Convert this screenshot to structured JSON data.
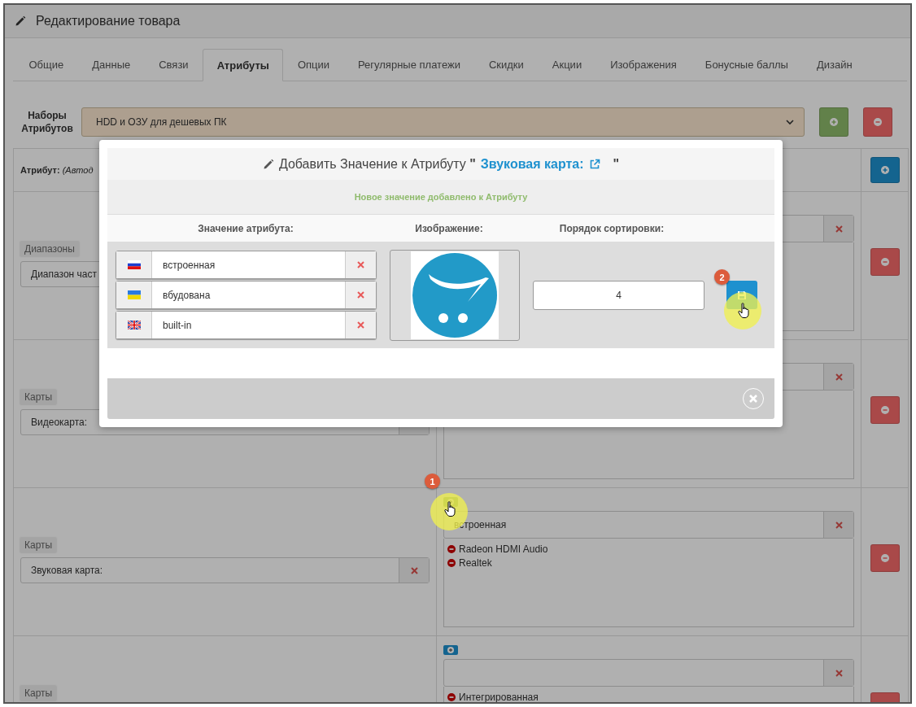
{
  "page": {
    "title": "Редактирование товара"
  },
  "tabs": [
    {
      "label": "Общие",
      "selected": false
    },
    {
      "label": "Данные",
      "selected": false
    },
    {
      "label": "Связи",
      "selected": false
    },
    {
      "label": "Атрибуты",
      "selected": true
    },
    {
      "label": "Опции",
      "selected": false
    },
    {
      "label": "Регулярные платежи",
      "selected": false
    },
    {
      "label": "Скидки",
      "selected": false
    },
    {
      "label": "Акции",
      "selected": false
    },
    {
      "label": "Изображения",
      "selected": false
    },
    {
      "label": "Бонусные баллы",
      "selected": false
    },
    {
      "label": "Дизайн",
      "selected": false
    }
  ],
  "attribute_set": {
    "label": "Наборы Атрибутов",
    "value": "HDD и ОЗУ для дешевых ПК"
  },
  "table": {
    "header": "**Атрибут:** *(Автод*",
    "rows": [
      {
        "group": "Диапазоны",
        "name": "Диапазон част"
      },
      {
        "group": "Карты",
        "name": "Видеокарта:",
        "clear_button": {
          "kind": "bare"
        }
      },
      {
        "group": "Карты",
        "name": "Звуковая карта:",
        "clear_button": {
          "kind": "icon"
        },
        "add_button": {
          "kind": "success"
        },
        "value": "встроенная",
        "values": [
          "Radeon HDMI Audio",
          "Realtek"
        ]
      },
      {
        "group": "Карты",
        "add_button": {
          "kind": "primary"
        },
        "values": [
          "Интегрированная"
        ]
      }
    ]
  },
  "modal": {
    "title": "Добавить Значение к Атрибуту **\"**",
    "link": "Звуковая карта:",
    "title_end": "\"",
    "message": "Новое значение добавлено к Атрибуту",
    "columns": [
      "Значение атрибута:",
      "Изображение:",
      "Порядок сортировки:"
    ],
    "values": [
      {
        "kind": "ru",
        "value": "встроенная"
      },
      {
        "kind": "ua",
        "value": "вбудована"
      },
      {
        "kind": "gb",
        "value": "built-in"
      }
    ],
    "sort_order": "4"
  },
  "annotations": [
    {
      "label": "1"
    },
    {
      "label": "2"
    }
  ]
}
